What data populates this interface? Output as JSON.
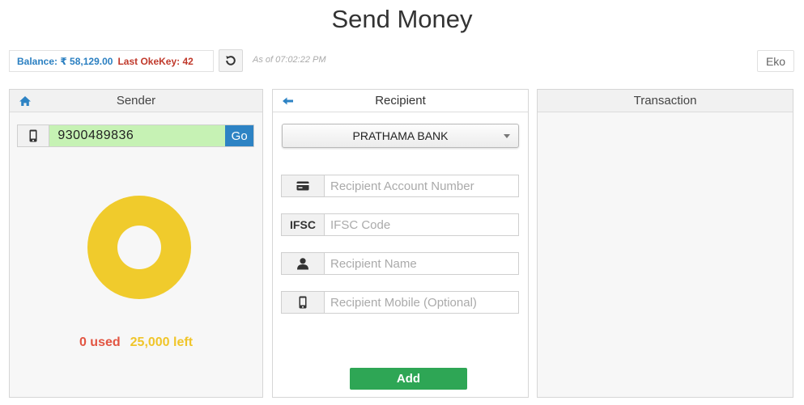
{
  "page_title": "Send Money",
  "status": {
    "balance": "Balance: ₹ 58,129.00",
    "okekey": "Last OkeKey: 42",
    "as_of": "As of 07:02:22 PM"
  },
  "agent_button": "Eko",
  "sender": {
    "title": "Sender",
    "mobile_value": "9300489836",
    "go_label": "Go",
    "used_label": "0 used",
    "left_label": "25,000 left",
    "limit_used_fraction": 0
  },
  "recipient": {
    "title": "Recipient",
    "bank_selected": "PRATHAMA BANK",
    "account_placeholder": "Recipient Account Number",
    "ifsc_addon": "IFSC",
    "ifsc_placeholder": "IFSC Code",
    "name_placeholder": "Recipient Name",
    "mobile_placeholder": "Recipient Mobile (Optional)",
    "add_label": "Add"
  },
  "transaction": {
    "title": "Transaction"
  },
  "colors": {
    "balance": "#2a7fc1",
    "okekey": "#c0392b",
    "mobile_bg": "#c6f2b4",
    "go_button": "#2d83c4",
    "donut": "#f0cb2c",
    "used": "#e25542",
    "left": "#f0c52a",
    "add_button": "#2ea655"
  }
}
